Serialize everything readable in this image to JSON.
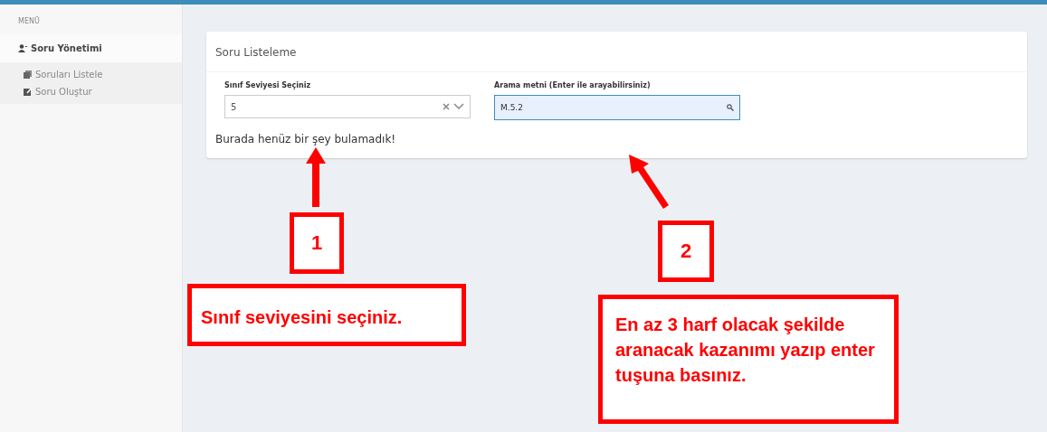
{
  "sidebar": {
    "heading": "MENÜ",
    "section": "Soru Yönetimi",
    "items": [
      {
        "label": "Soruları Listele",
        "kind": "list"
      },
      {
        "label": "Soru Oluştur",
        "kind": "create"
      }
    ]
  },
  "card": {
    "title": "Soru Listeleme",
    "grade_field": {
      "label": "Sınıf Seviyesi Seçiniz",
      "value": "5"
    },
    "search_field": {
      "label": "Arama metni (Enter ile arayabilirsiniz)",
      "value": "M.5.2"
    },
    "empty_message": "Burada henüz bir şey bulamadık!"
  },
  "callouts": [
    {
      "number": "1",
      "text": "Sınıf seviyesini seçiniz."
    },
    {
      "number": "2",
      "text": "En az 3 harf olacak şekilde aranacak kazanımı yazıp enter tuşuna basınız."
    }
  ]
}
